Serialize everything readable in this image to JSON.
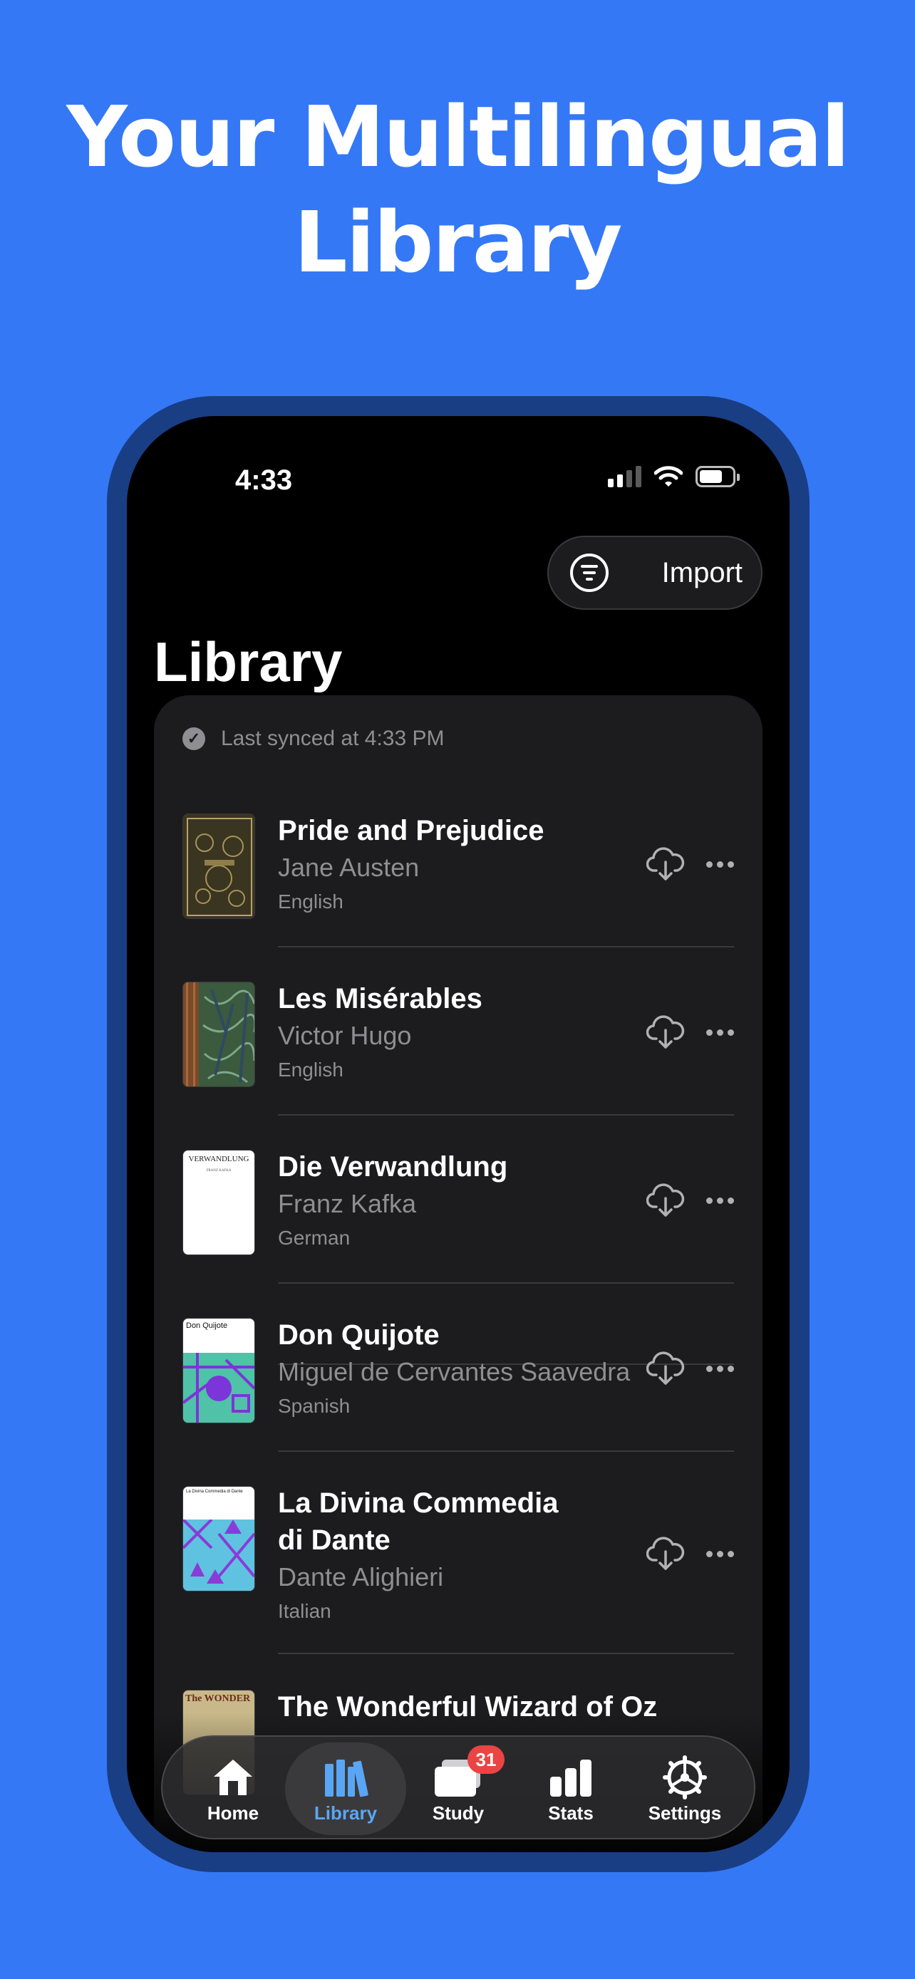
{
  "headline": {
    "line1": "Your Multilingual",
    "line2": "Library"
  },
  "status_bar": {
    "time": "4:33"
  },
  "toolbar": {
    "import_label": "Import"
  },
  "page": {
    "title": "Library"
  },
  "sync": {
    "text": "Last synced at 4:33 PM"
  },
  "books": [
    {
      "title": "Pride and Prejudice",
      "author": "Jane Austen",
      "language": "English"
    },
    {
      "title": "Les Misérables",
      "author": "Victor Hugo",
      "language": "English"
    },
    {
      "title": "Die Verwandlung",
      "author": "Franz Kafka",
      "language": "German"
    },
    {
      "title": "Don Quijote",
      "author": "Miguel de Cervantes Saavedra",
      "language": "Spanish"
    },
    {
      "title_line1": "La Divina Commedia",
      "title_line2": "di Dante",
      "author": "Dante Alighieri",
      "language": "Italian"
    },
    {
      "title": "The Wonderful Wizard of Oz"
    }
  ],
  "covers": {
    "die_verwandlung": {
      "title": "VERWANDLUNG",
      "author": "FRANZ KAFKA"
    },
    "don_quijote": {
      "title": "Don Quijote"
    },
    "divina_commedia": {
      "title": "La Divina Commedia di Dante"
    },
    "wizard_of_oz": {
      "title": "The WONDER"
    }
  },
  "tabs": [
    {
      "label": "Home"
    },
    {
      "label": "Library"
    },
    {
      "label": "Study",
      "badge": "31"
    },
    {
      "label": "Stats"
    },
    {
      "label": "Settings"
    }
  ],
  "colors": {
    "background": "#3478F6",
    "accent": "#5AA6F5",
    "badge": "#EB4444"
  }
}
